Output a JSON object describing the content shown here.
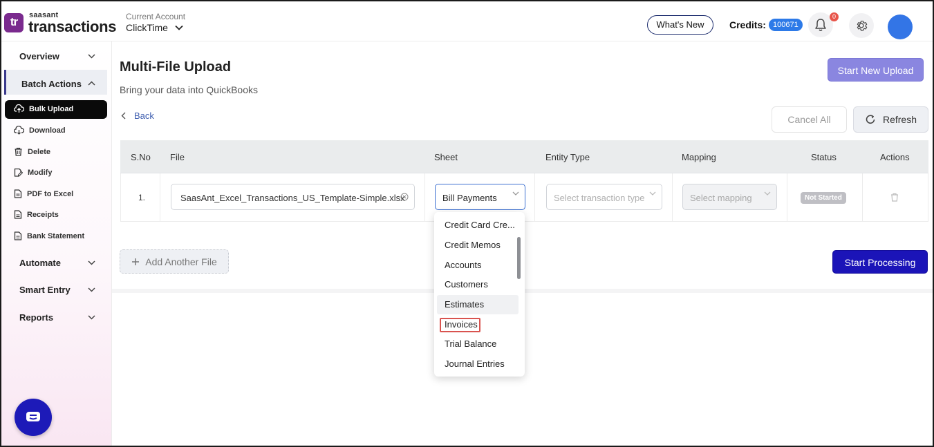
{
  "header": {
    "logo_icon": "tr",
    "brand_top": "saasant",
    "brand_main": "transactions",
    "account_label": "Current Account",
    "account_value": "ClickTime",
    "whats_new": "What's New",
    "credits_label": "Credits:",
    "credits_value": "100671",
    "notification_count": "0"
  },
  "sidebar": {
    "overview": "Overview",
    "batch_actions": "Batch Actions",
    "sub_items": [
      {
        "label": "Bulk Upload",
        "icon": "upload-cloud-icon"
      },
      {
        "label": "Download",
        "icon": "download-cloud-icon"
      },
      {
        "label": "Delete",
        "icon": "trash-icon"
      },
      {
        "label": "Modify",
        "icon": "edit-file-icon"
      },
      {
        "label": "PDF to Excel",
        "icon": "file-icon"
      },
      {
        "label": "Receipts",
        "icon": "file-icon"
      },
      {
        "label": "Bank Statement",
        "icon": "file-icon"
      }
    ],
    "automate": "Automate",
    "smart_entry": "Smart Entry",
    "reports": "Reports"
  },
  "main": {
    "title": "Multi-File Upload",
    "subtitle": "Bring your data into QuickBooks",
    "start_new_upload": "Start New Upload",
    "back": "Back",
    "cancel_all": "Cancel All",
    "refresh": "Refresh",
    "add_another_file": "Add Another File",
    "start_processing": "Start Processing"
  },
  "table": {
    "columns": [
      "S.No",
      "File",
      "Sheet",
      "Entity Type",
      "Mapping",
      "Status",
      "Actions"
    ],
    "rows": [
      {
        "sno": "1.",
        "file": "SaasAnt_Excel_Transactions_US_Template-Simple.xlsx",
        "sheet": "Bill Payments",
        "entity_placeholder": "Select transaction type",
        "mapping_placeholder": "Select mapping",
        "status": "Not Started"
      }
    ]
  },
  "sheet_dropdown": {
    "options": [
      "Credit Card Cre...",
      "Credit Memos",
      "Accounts",
      "Customers",
      "Estimates",
      "Invoices",
      "Trial Balance",
      "Journal Entries"
    ],
    "hovered": "Estimates",
    "highlighted": "Invoices"
  },
  "colors": {
    "brand_purple": "#7a2a8e",
    "primary_blue": "#1b14b8",
    "light_purple_button": "#8a86e0",
    "credits_badge": "#2d7ae8",
    "notification_red": "#e8554a",
    "highlight_outline": "#d9534f"
  }
}
